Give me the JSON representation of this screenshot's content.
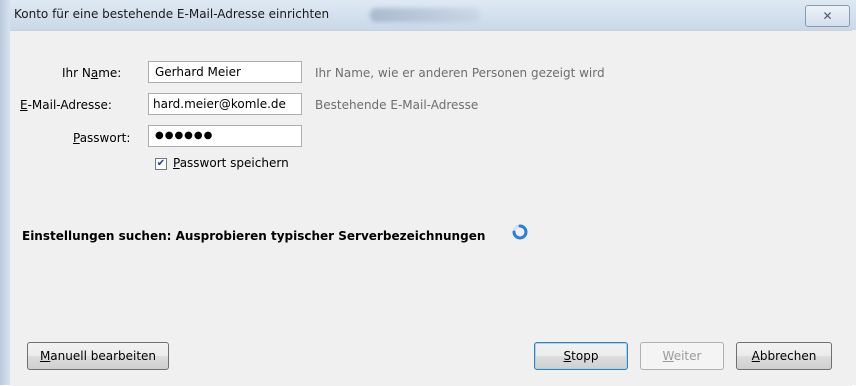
{
  "window": {
    "title": "Konto für eine bestehende E-Mail-Adresse einrichten",
    "close_glyph": "✕"
  },
  "form": {
    "name": {
      "label_access": "Ihr N",
      "label_u": "a",
      "label_rest": "me:",
      "value": "Gerhard Meier",
      "hint": "Ihr Name, wie er anderen Personen gezeigt wird"
    },
    "email": {
      "label_u": "E",
      "label_rest": "-Mail-Adresse:",
      "value": "hard.meier@komle.de",
      "hint": "Bestehende E-Mail-Adresse"
    },
    "password": {
      "label_u": "P",
      "label_rest": "asswort:",
      "value": "●●●●●●"
    },
    "remember": {
      "label_u": "P",
      "label_rest": "asswort speichern",
      "checked_glyph": "✔"
    }
  },
  "status_text": "Einstellungen suchen: Ausprobieren typischer Serverbezeichnungen",
  "buttons": {
    "manual": {
      "u": "M",
      "rest": "anuell bearbeiten"
    },
    "stop": {
      "u": "S",
      "rest": "topp"
    },
    "next": {
      "u": "W",
      "rest": "eiter"
    },
    "cancel": {
      "u": "A",
      "rest": "bbrechen"
    }
  },
  "colors": {
    "spinner": "#2a7fd4",
    "hint_text": "#6d6d6d"
  },
  "icons": [
    "close-icon",
    "checkbox-checked-icon",
    "loading-spinner-icon"
  ]
}
